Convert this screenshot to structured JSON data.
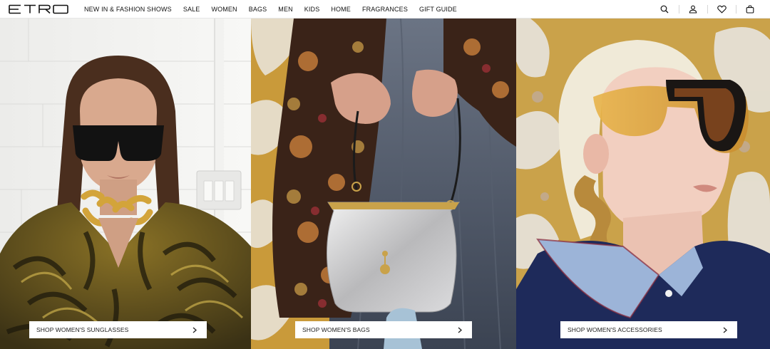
{
  "brand": {
    "logo_text": "ETRO"
  },
  "nav": {
    "items": [
      {
        "label": "NEW IN & FASHION SHOWS"
      },
      {
        "label": "SALE"
      },
      {
        "label": "WOMEN"
      },
      {
        "label": "BAGS"
      },
      {
        "label": "MEN"
      },
      {
        "label": "KIDS"
      },
      {
        "label": "HOME"
      },
      {
        "label": "FRAGRANCES"
      },
      {
        "label": "GIFT GUIDE"
      }
    ]
  },
  "utilities": {
    "icons": [
      "search-icon",
      "account-icon",
      "wishlist-heart-icon",
      "shopping-bag-icon"
    ]
  },
  "panels": [
    {
      "cta_label": "SHOP WOMEN'S SUNGLASSES",
      "image": "woman-in-sunglasses-and-gold-chain-necklace"
    },
    {
      "cta_label": "SHOP WOMEN'S BAGS",
      "image": "silver-mini-bag-held-over-denim"
    },
    {
      "cta_label": "SHOP WOMEN'S ACCESSORIES",
      "image": "blonde-woman-in-cat-eye-sunglasses-and-gold-earring"
    }
  ],
  "colors": {
    "background": "#ffffff",
    "text": "#111111",
    "wallpaper_yellow": "#c99a3a",
    "denim": "#4a5668"
  }
}
